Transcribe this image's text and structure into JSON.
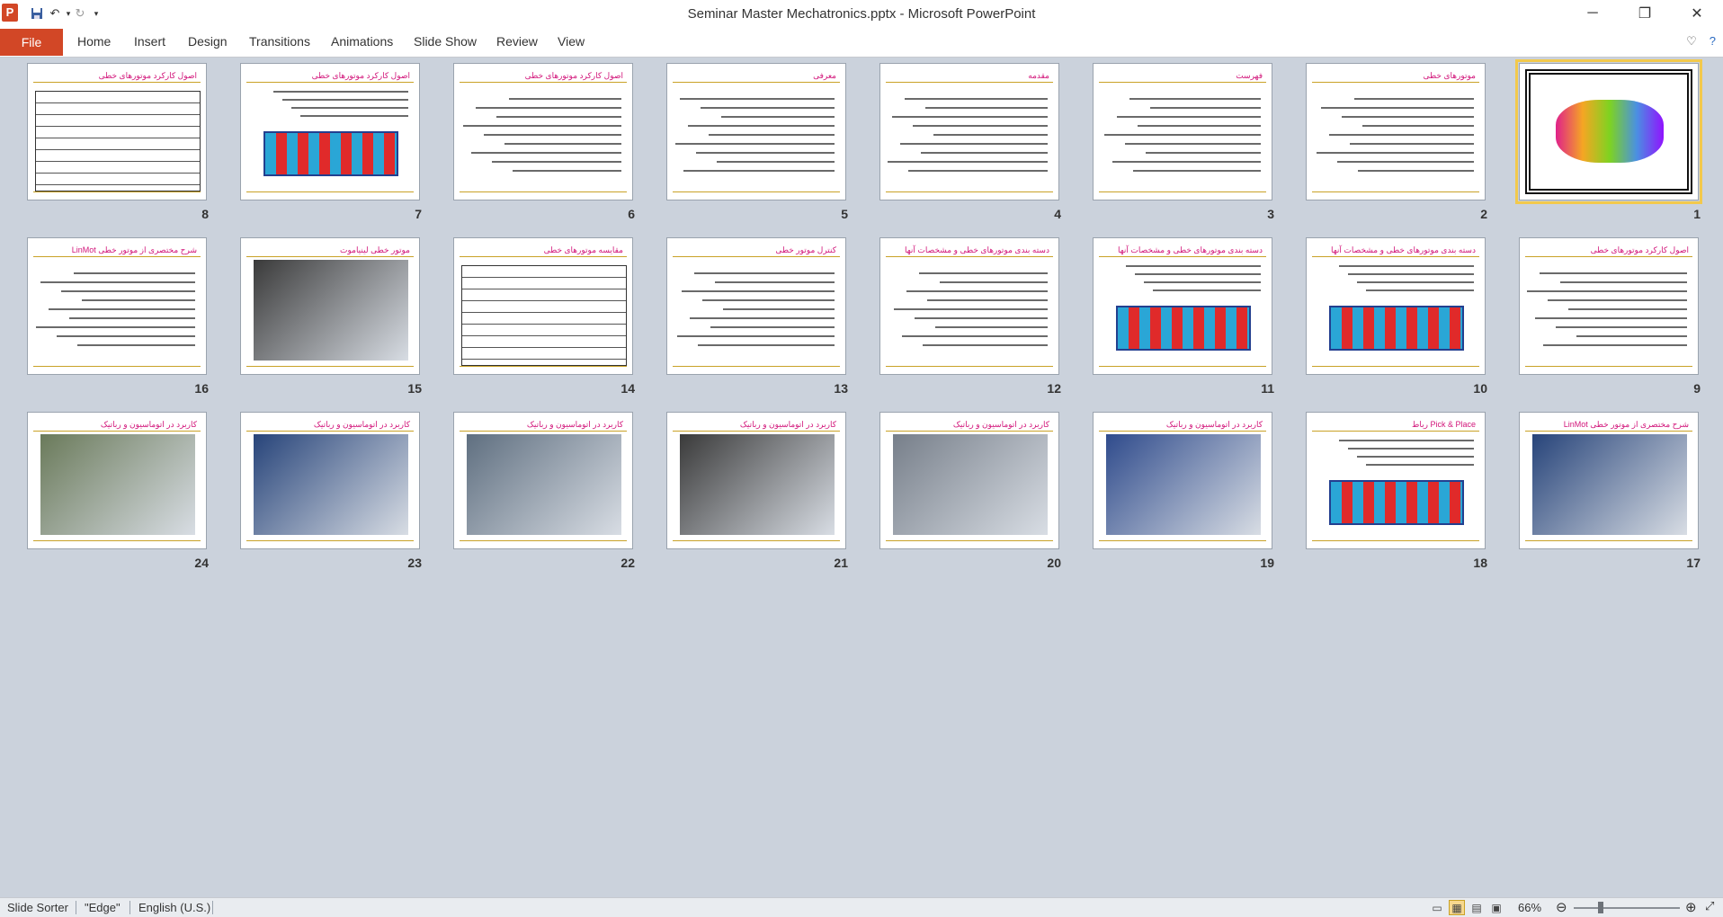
{
  "window": {
    "title": "Seminar Master Mechatronics.pptx  -  Microsoft PowerPoint",
    "app_icon": "P",
    "controls": [
      "─",
      "❐",
      "✕"
    ]
  },
  "quick_access": {
    "save_icon": "save-icon",
    "undo_icon": "undo-icon",
    "redo_icon": "redo-icon",
    "customize_icon": "customize-icon"
  },
  "ribbon": {
    "file_label": "File",
    "tabs": [
      "Home",
      "Insert",
      "Design",
      "Transitions",
      "Animations",
      "Slide Show",
      "Review",
      "View"
    ]
  },
  "slides": [
    {
      "n": "1",
      "kind": "calligraphy",
      "title": "بسم الله الرحمن الرحيم"
    },
    {
      "n": "2",
      "kind": "text",
      "title": "موتورهای خطی"
    },
    {
      "n": "3",
      "kind": "text",
      "title": "فهرست"
    },
    {
      "n": "4",
      "kind": "text",
      "title": "مقدمه"
    },
    {
      "n": "5",
      "kind": "text",
      "title": "معرفی"
    },
    {
      "n": "6",
      "kind": "text",
      "title": "اصول کارکرد موتورهای خطی"
    },
    {
      "n": "7",
      "kind": "diagram",
      "title": "اصول کارکرد موتورهای خطی"
    },
    {
      "n": "8",
      "kind": "table",
      "title": "اصول کارکرد موتورهای خطی"
    },
    {
      "n": "9",
      "kind": "text",
      "title": "اصول کارکرد موتورهای خطی"
    },
    {
      "n": "10",
      "kind": "diagram",
      "title": "دسته بندی موتورهای خطی و مشخصات آنها"
    },
    {
      "n": "11",
      "kind": "diagram",
      "title": "دسته بندی موتورهای خطی و مشخصات آنها"
    },
    {
      "n": "12",
      "kind": "text",
      "title": "دسته بندی موتورهای خطی و مشخصات آنها"
    },
    {
      "n": "13",
      "kind": "text",
      "title": "کنترل موتور خطی"
    },
    {
      "n": "14",
      "kind": "table",
      "title": "مقایسه موتورهای خطی"
    },
    {
      "n": "15",
      "kind": "photo",
      "title": "موتور خطی لینیاموت"
    },
    {
      "n": "16",
      "kind": "text",
      "title": "شرح مختصری از موتور خطی LinMot"
    },
    {
      "n": "17",
      "kind": "photo",
      "title": "شرح مختصری از موتور خطی LinMot"
    },
    {
      "n": "18",
      "kind": "diagram",
      "title": "Pick & Place رباط"
    },
    {
      "n": "19",
      "kind": "photo",
      "title": "کاربرد در اتوماسیون و رباتیک"
    },
    {
      "n": "20",
      "kind": "photo",
      "title": "کاربرد در اتوماسیون و رباتیک"
    },
    {
      "n": "21",
      "kind": "photo",
      "title": "کاربرد در اتوماسیون و رباتیک"
    },
    {
      "n": "22",
      "kind": "photo",
      "title": "کاربرد در اتوماسیون و رباتیک"
    },
    {
      "n": "23",
      "kind": "photo",
      "title": "کاربرد در اتوماسیون و رباتیک"
    },
    {
      "n": "24",
      "kind": "photo",
      "title": "کاربرد در اتوماسیون و رباتیک"
    }
  ],
  "statusbar": {
    "view": "Slide Sorter",
    "theme": "\"Edge\"",
    "language": "English (U.S.)",
    "zoom": "66%",
    "zoom_fraction": 0.25
  }
}
